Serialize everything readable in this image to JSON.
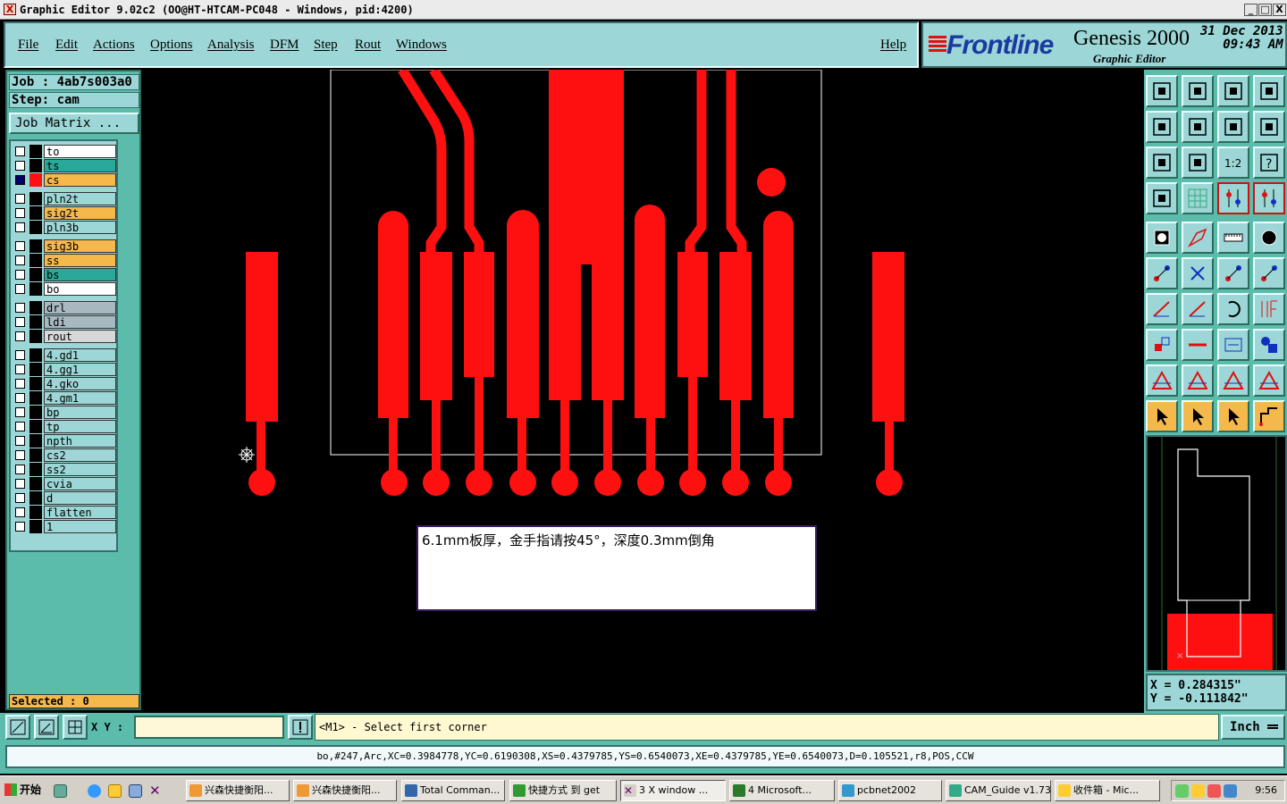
{
  "window": {
    "title": "Graphic Editor 9.02c2  (OO@HT-HTCAM-PC048 - Windows, pid:4200)",
    "minimize": "_",
    "maximize": "□",
    "close": "X"
  },
  "menu": {
    "items": [
      "File",
      "Edit",
      "Actions",
      "Options",
      "Analysis",
      "DFM",
      "Step",
      "Rout",
      "Windows"
    ],
    "help": "Help"
  },
  "brand": {
    "logo": "Frontline",
    "product": "Genesis 2000",
    "subtitle": "Graphic Editor",
    "date": "31 Dec 2013",
    "time": "09:43 AM"
  },
  "job": {
    "job_line": "Job : 4ab7s003a0",
    "step_line": "Step: cam",
    "matrix_button": "Job Matrix ..."
  },
  "layers": [
    {
      "name": "to",
      "color": "#ffffff"
    },
    {
      "name": "ts",
      "color": "#2aa898"
    },
    {
      "name": "cs",
      "color": "#f5b84a",
      "active": true
    },
    {
      "name": "pln2t",
      "color": "#9cd6d6"
    },
    {
      "name": "sig2t",
      "color": "#f5b84a"
    },
    {
      "name": "pln3b",
      "color": "#9cd6d6"
    },
    {
      "name": "sig3b",
      "color": "#f5b84a"
    },
    {
      "name": "ss",
      "color": "#f5b84a"
    },
    {
      "name": "bs",
      "color": "#2aa898"
    },
    {
      "name": "bo",
      "color": "#ffffff"
    },
    {
      "name": "drl",
      "color": "#a8b8c0"
    },
    {
      "name": "ldi",
      "color": "#a8b8c0"
    },
    {
      "name": "rout",
      "color": "#d8d8d8"
    },
    {
      "name": "4.gd1",
      "color": "#9cd6d6"
    },
    {
      "name": "4.gg1",
      "color": "#9cd6d6"
    },
    {
      "name": "4.gko",
      "color": "#9cd6d6"
    },
    {
      "name": "4.gm1",
      "color": "#9cd6d6"
    },
    {
      "name": "bp",
      "color": "#9cd6d6"
    },
    {
      "name": "tp",
      "color": "#9cd6d6"
    },
    {
      "name": "npth",
      "color": "#9cd6d6"
    },
    {
      "name": "cs2",
      "color": "#9cd6d6"
    },
    {
      "name": "ss2",
      "color": "#9cd6d6"
    },
    {
      "name": "cvia",
      "color": "#9cd6d6"
    },
    {
      "name": "d",
      "color": "#9cd6d6"
    },
    {
      "name": "flatten",
      "color": "#9cd6d6"
    },
    {
      "name": "1",
      "color": "#9cd6d6"
    }
  ],
  "selected": "Selected : 0",
  "note": "6.1mm板厚，金手指请按45°，深度0.3mm倒角",
  "cursor_coords": {
    "x": "X = 0.284315\"",
    "y": "Y = -0.111842\""
  },
  "command": {
    "xy_label": "X Y :",
    "xy_value": "",
    "prompt": "<M1> - Select first corner",
    "units": "Inch"
  },
  "status_line": "bo,#247,Arc,XC=0.3984778,YC=0.6190308,XS=0.4379785,YS=0.6540073,XE=0.4379785,YE=0.6540073,D=0.105521,r8,POS,CCW",
  "taskbar": {
    "start": "开始",
    "tasks": [
      "兴森快捷衡阳...",
      "兴森快捷衡阳...",
      "Total Comman...",
      "快捷方式 到 get",
      "3 X window ...",
      "4 Microsoft...",
      "pcbnet2002",
      "CAM_Guide v1.73",
      "收件箱 - Mic..."
    ],
    "clock": "9:56"
  },
  "colors": {
    "panel": "#9cd6d6",
    "panel_dark": "#5cbcac",
    "copper": "#ff1010",
    "highlight": "#f5b84a"
  }
}
